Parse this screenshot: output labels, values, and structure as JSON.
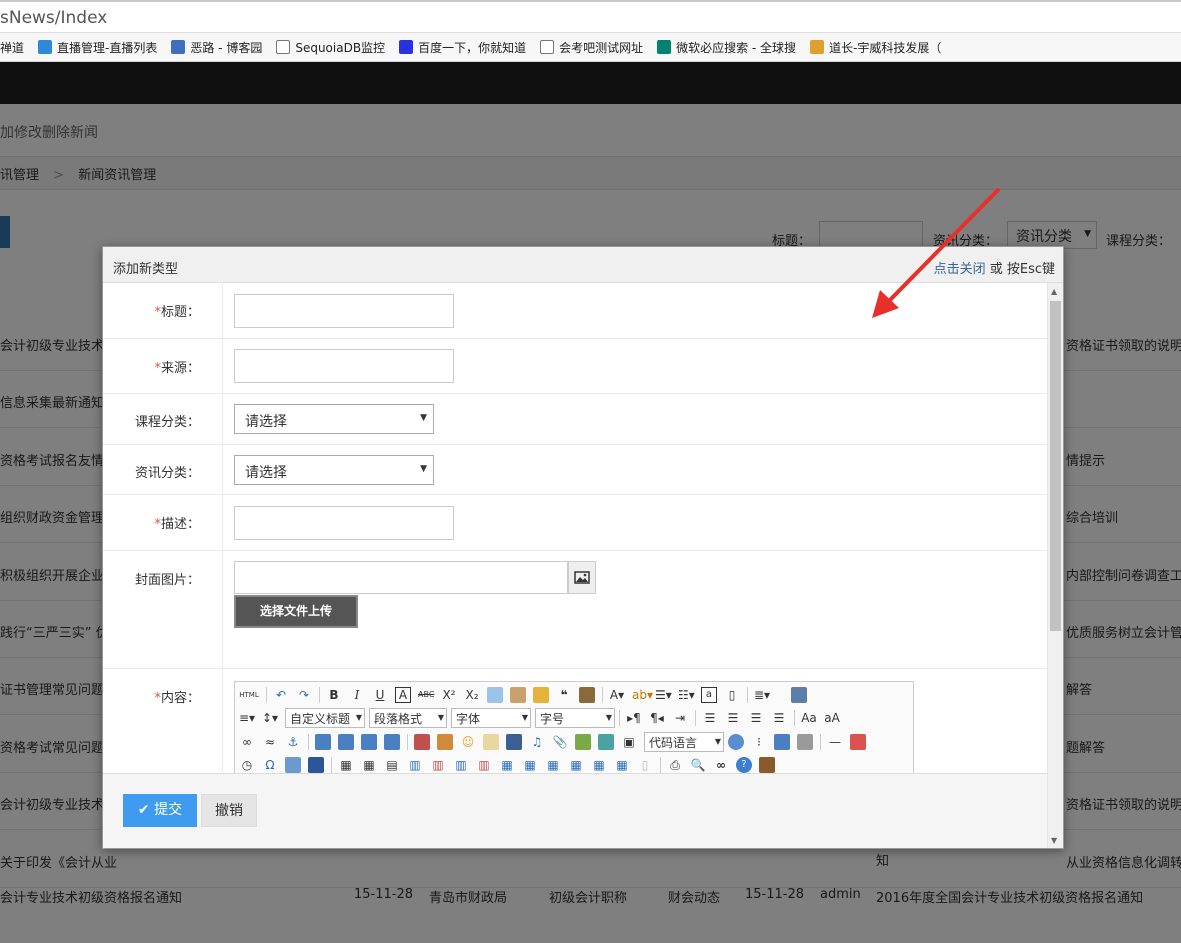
{
  "browser": {
    "url": "sNews/Index",
    "bookmarks": [
      {
        "label": "禅道",
        "icon": "bookmark-icon",
        "color": "#6a8fc7"
      },
      {
        "label": "直播管理-直播列表",
        "icon": "cloud-icon",
        "color": "#2e89d8"
      },
      {
        "label": "恶路 - 博客园",
        "icon": "blog-icon",
        "color": "#3f6ec0"
      },
      {
        "label": "SequoiaDB监控",
        "icon": "page-icon",
        "color": "#ffffff"
      },
      {
        "label": "百度一下，你就知道",
        "icon": "baidu-icon",
        "color": "#2932e1"
      },
      {
        "label": "会考吧测试网址",
        "icon": "page-icon",
        "color": "#ffffff"
      },
      {
        "label": "微软必应搜索 - 全球搜",
        "icon": "bing-icon",
        "color": "#008373"
      },
      {
        "label": "道长-宇威科技发展（",
        "icon": "chart-icon",
        "color": "#e0a030"
      }
    ]
  },
  "page": {
    "title": "加修改删除新闻",
    "breadcrumb": [
      "讯管理",
      "新闻资讯管理"
    ],
    "breadcrumb_sep": ">",
    "filters": {
      "title_label": "标题：",
      "category_label": "资讯分类：",
      "category_value": "资讯分类",
      "course_label": "课程分类："
    },
    "rows": [
      {
        "left": "会计初级专业技术",
        "right": "资格证书领取的说明"
      },
      {
        "left": "信息采集最新通知",
        "right": ""
      },
      {
        "left": "资格考试报名友情",
        "right": "情提示"
      },
      {
        "left": "组织财政资金管理",
        "right": "综合培训"
      },
      {
        "left": "积极组织开展企业内",
        "right": "内部控制问卷调查工作"
      },
      {
        "left": "践行“三严三实” 优",
        "right": "优质服务树立会计管"
      },
      {
        "left": "证书管理常见问题解",
        "right": "解答"
      },
      {
        "left": "资格考试常见问题",
        "right": "题解答"
      },
      {
        "left": "会计初级专业技术",
        "right": "资格证书领取的说明"
      },
      {
        "left": "关于印发《会计从业",
        "right": "从业资格信息化调转有关"
      }
    ],
    "partial_row_text": "知",
    "last_row": {
      "title": "会计专业技术初级资格报名通知",
      "date1": "15-11-28",
      "source": "青岛市财政局",
      "course": "初级会计职称",
      "category": "财会动态",
      "date2": "15-11-28",
      "author": "admin",
      "desc": "2016年度全国会计专业技术初级资格报名通知"
    }
  },
  "modal": {
    "title": "添加新类型",
    "close_link": "点击关闭",
    "close_hint": " 或 按Esc键",
    "fields": {
      "title_label": "标题：",
      "source_label": "来源：",
      "course_label": "课程分类：",
      "course_value": "请选择",
      "category_label": "资讯分类：",
      "category_value": "请选择",
      "desc_label": "描述：",
      "cover_label": "封面图片：",
      "upload_label": "选择文件上传",
      "content_label": "内容：",
      "required_mark": "*"
    },
    "editor": {
      "heading_select": "自定义标题",
      "paragraph_select": "段落格式",
      "font_select": "字体",
      "size_select": "字号",
      "code_select": "代码语言",
      "html_btn": "HTML"
    },
    "submit_label": "提交",
    "cancel_label": "撤销"
  },
  "colors": {
    "annotation_arrow": "#e8302a",
    "submit": "#3e9bf0",
    "required": "#e84c3d"
  }
}
